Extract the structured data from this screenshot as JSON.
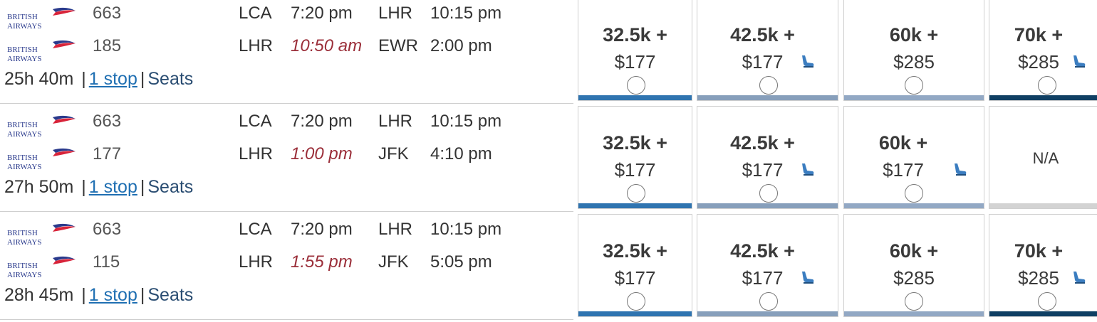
{
  "colors": {
    "main": "#2f74b0",
    "saver": "#879fbb",
    "refundable": "#92a8c4",
    "first": "#0f3f63",
    "na": "#d3d3d3",
    "delay_red": "#9b2f3a",
    "link_blue": "#1f6fb2"
  },
  "brand": {
    "logo_line1": "BRITISH",
    "logo_line2": "AIRWAYS"
  },
  "rows": [
    {
      "duration": "25h 40m",
      "stops_label": "1 stop",
      "seats_label": "Seats",
      "segments": [
        {
          "flight": "663",
          "from": "LCA",
          "depart": "7:20 pm",
          "depart_delayed": false,
          "to": "LHR",
          "arrive": "10:15 pm"
        },
        {
          "flight": "185",
          "from": "LHR",
          "depart": "10:50 am",
          "depart_delayed": true,
          "to": "EWR",
          "arrive": "2:00 pm"
        }
      ],
      "fares": [
        {
          "points": "32.5k +",
          "price": "$177",
          "seat_icon": false,
          "bar": "main"
        },
        {
          "points": "42.5k +",
          "price": "$177",
          "seat_icon": true,
          "bar": "saver"
        },
        {
          "points": "60k +",
          "price": "$285",
          "seat_icon": false,
          "bar": "refundable"
        },
        {
          "points": "70k +",
          "price": "$285",
          "seat_icon": true,
          "bar": "first"
        }
      ]
    },
    {
      "duration": "27h 50m",
      "stops_label": "1 stop",
      "seats_label": "Seats",
      "segments": [
        {
          "flight": "663",
          "from": "LCA",
          "depart": "7:20 pm",
          "depart_delayed": false,
          "to": "LHR",
          "arrive": "10:15 pm"
        },
        {
          "flight": "177",
          "from": "LHR",
          "depart": "1:00 pm",
          "depart_delayed": true,
          "to": "JFK",
          "arrive": "4:10 pm"
        }
      ],
      "fares": [
        {
          "points": "32.5k +",
          "price": "$177",
          "seat_icon": false,
          "bar": "main"
        },
        {
          "points": "42.5k +",
          "price": "$177",
          "seat_icon": true,
          "bar": "saver"
        },
        {
          "points": "60k +",
          "price": "$177",
          "seat_icon": true,
          "bar": "refundable"
        },
        {
          "na": "N/A",
          "bar": "na"
        }
      ]
    },
    {
      "duration": "28h 45m",
      "stops_label": "1 stop",
      "seats_label": "Seats",
      "segments": [
        {
          "flight": "663",
          "from": "LCA",
          "depart": "7:20 pm",
          "depart_delayed": false,
          "to": "LHR",
          "arrive": "10:15 pm"
        },
        {
          "flight": "115",
          "from": "LHR",
          "depart": "1:55 pm",
          "depart_delayed": true,
          "to": "JFK",
          "arrive": "5:05 pm"
        }
      ],
      "fares": [
        {
          "points": "32.5k +",
          "price": "$177",
          "seat_icon": false,
          "bar": "main"
        },
        {
          "points": "42.5k +",
          "price": "$177",
          "seat_icon": true,
          "bar": "saver"
        },
        {
          "points": "60k +",
          "price": "$285",
          "seat_icon": false,
          "bar": "refundable"
        },
        {
          "points": "70k +",
          "price": "$285",
          "seat_icon": true,
          "bar": "first"
        }
      ]
    }
  ]
}
